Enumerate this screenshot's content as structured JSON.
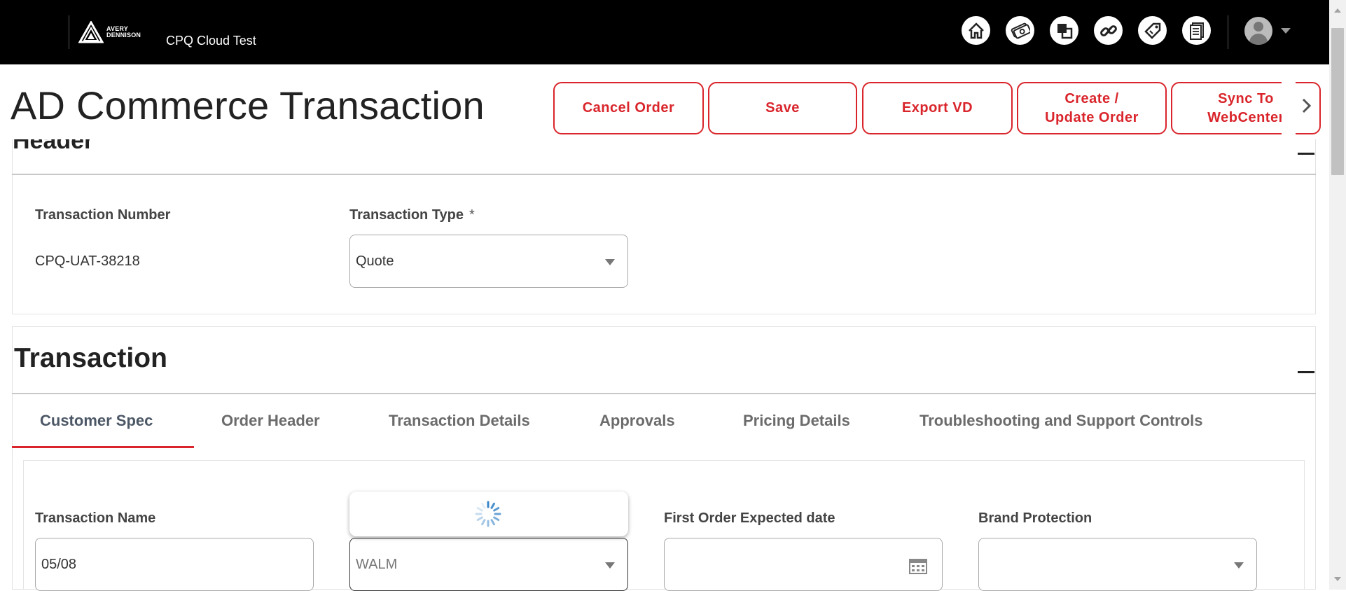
{
  "topbar": {
    "brand_line1": "AVERY",
    "brand_line2": "DENNISON",
    "app_title": "CPQ Cloud Test",
    "nav_icons": [
      "home-icon",
      "money-icon",
      "copy-icon",
      "link-icon",
      "tag-icon",
      "document-icon"
    ]
  },
  "page": {
    "title": "AD Commerce Transaction"
  },
  "actions": {
    "cancel_order": "Cancel Order",
    "save": "Save",
    "export_vd": "Export VD",
    "create_update_line1": "Create /",
    "create_update_line2": "Update Order",
    "sync_line1": "Sync To",
    "sync_line2": "WebCenter"
  },
  "header_section": {
    "title": "Header",
    "transaction_number_label": "Transaction Number",
    "transaction_number_value": "CPQ-UAT-38218",
    "transaction_type_label": "Transaction Type",
    "required_marker": "*",
    "transaction_type_value": "Quote"
  },
  "transaction_section": {
    "title": "Transaction",
    "tabs": [
      {
        "label": "Customer Spec",
        "active": true
      },
      {
        "label": "Order Header",
        "active": false
      },
      {
        "label": "Transaction Details",
        "active": false
      },
      {
        "label": "Approvals",
        "active": false
      },
      {
        "label": "Pricing Details",
        "active": false
      },
      {
        "label": "Troubleshooting and Support Controls",
        "active": false
      }
    ],
    "fields": {
      "transaction_name_label": "Transaction Name",
      "transaction_name_value": "05/08",
      "retailer_value": "WALM",
      "first_order_label": "First Order Expected date",
      "first_order_value": "",
      "brand_protection_label": "Brand Protection",
      "brand_protection_value": ""
    }
  },
  "colors": {
    "accent": "#d9252b",
    "topbar": "#000000",
    "spinner": "#3a86c8"
  }
}
